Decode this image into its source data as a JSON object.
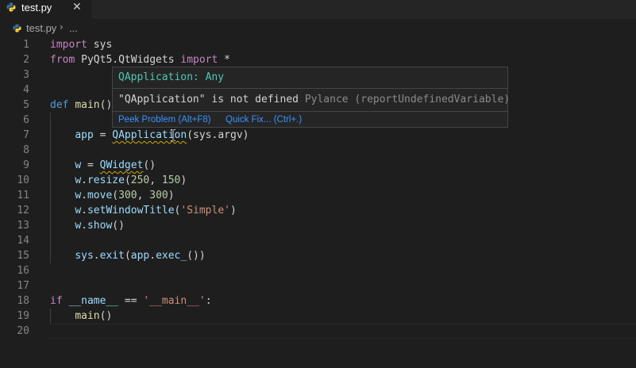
{
  "tab": {
    "filename": "test.py",
    "close": "✕"
  },
  "breadcrumb": {
    "file": "test.py",
    "separator": "›",
    "more": "..."
  },
  "colors": {
    "python_icon_blue": "#3572a5",
    "python_icon_yellow": "#ffd43b",
    "warning_squiggle": "#cca700",
    "link": "#3794ff"
  },
  "lines": [
    {
      "n": "1"
    },
    {
      "n": "2"
    },
    {
      "n": "3"
    },
    {
      "n": "4"
    },
    {
      "n": "5"
    },
    {
      "n": "6"
    },
    {
      "n": "7"
    },
    {
      "n": "8"
    },
    {
      "n": "9"
    },
    {
      "n": "10"
    },
    {
      "n": "11"
    },
    {
      "n": "12"
    },
    {
      "n": "13"
    },
    {
      "n": "14"
    },
    {
      "n": "15"
    },
    {
      "n": "16"
    },
    {
      "n": "17"
    },
    {
      "n": "18"
    },
    {
      "n": "19"
    },
    {
      "n": "20"
    }
  ],
  "code": {
    "l1": [
      "import",
      " sys"
    ],
    "l2": [
      "from",
      " PyQt5.QtWidgets ",
      "import",
      " *"
    ],
    "l5": [
      "def",
      " ",
      "main",
      "()"
    ],
    "l7": [
      "    ",
      "app",
      " = ",
      "QApplication",
      "(sys.argv)"
    ],
    "l9": [
      "    ",
      "w",
      " = ",
      "QWidget",
      "()"
    ],
    "l10": [
      "    ",
      "w",
      ".",
      "resize",
      "(",
      "250",
      ", ",
      "150",
      ")"
    ],
    "l11": [
      "    ",
      "w",
      ".",
      "move",
      "(",
      "300",
      ", ",
      "300",
      ")"
    ],
    "l12": [
      "    ",
      "w",
      ".",
      "setWindowTitle",
      "(",
      "'Simple'",
      ")"
    ],
    "l13": [
      "    ",
      "w",
      ".",
      "show",
      "()"
    ],
    "l15": [
      "    ",
      "sys",
      ".",
      "exit",
      "(",
      "app",
      ".",
      "exec_",
      "())"
    ],
    "l18": [
      "if",
      " ",
      "__name__",
      " == ",
      "'__main__'",
      ":"
    ],
    "l19": [
      "    ",
      "main",
      "()"
    ]
  },
  "hover": {
    "signature": "QApplication: Any",
    "message": "\"QApplication\" is not defined",
    "source": "Pylance (reportUndefinedVariable)",
    "peek_problem": "Peek Problem (Alt+F8)",
    "quick_fix": "Quick Fix... (Ctrl+.)"
  }
}
